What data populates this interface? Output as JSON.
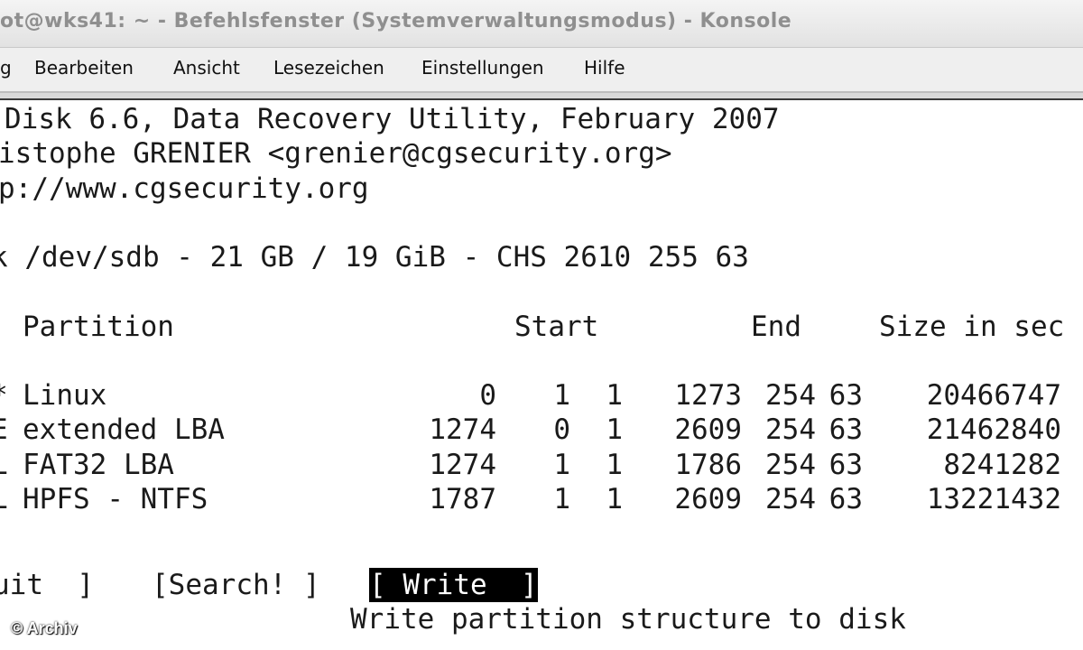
{
  "window": {
    "title": "ot@wks41: ~ - Befehlsfenster (Systemverwaltungsmodus) - Konsole"
  },
  "menu": {
    "items": [
      {
        "label": "g"
      },
      {
        "label": "Bearbeiten"
      },
      {
        "label": "Ansicht"
      },
      {
        "label": "Lesezeichen"
      },
      {
        "label": "Einstellungen"
      },
      {
        "label": "Hilfe"
      }
    ]
  },
  "terminal": {
    "header_lines": [
      "Disk 6.6, Data Recovery Utility, February 2007",
      "istophe GRENIER <grenier@cgsecurity.org>",
      "p://www.cgsecurity.org"
    ],
    "disk_line": "k /dev/sdb - 21 GB / 19 GiB - CHS 2610 255 63",
    "columns": {
      "partition": "Partition",
      "start": "Start",
      "end": "End",
      "size": "Size in sec"
    },
    "rows": [
      {
        "flag": "*",
        "type": "Linux",
        "start_c": "0",
        "start_h": "1",
        "start_s": "1",
        "end_c": "1273",
        "end_h": "254",
        "end_s": "63",
        "size": "20466747"
      },
      {
        "flag": "E",
        "type": "extended LBA",
        "start_c": "1274",
        "start_h": "0",
        "start_s": "1",
        "end_c": "2609",
        "end_h": "254",
        "end_s": "63",
        "size": "21462840"
      },
      {
        "flag": "L",
        "type": "FAT32 LBA",
        "start_c": "1274",
        "start_h": "1",
        "start_s": "1",
        "end_c": "1786",
        "end_h": "254",
        "end_s": "63",
        "size": "8241282"
      },
      {
        "flag": "L",
        "type": "HPFS - NTFS",
        "start_c": "1787",
        "start_h": "1",
        "start_s": "1",
        "end_c": "2609",
        "end_h": "254",
        "end_s": "63",
        "size": "13221432"
      }
    ],
    "actions": {
      "quit": "uit  ]",
      "search": "[Search! ]",
      "write": "[ Write  ]"
    },
    "status": "Write partition structure to disk"
  },
  "watermark": "© Archiv"
}
